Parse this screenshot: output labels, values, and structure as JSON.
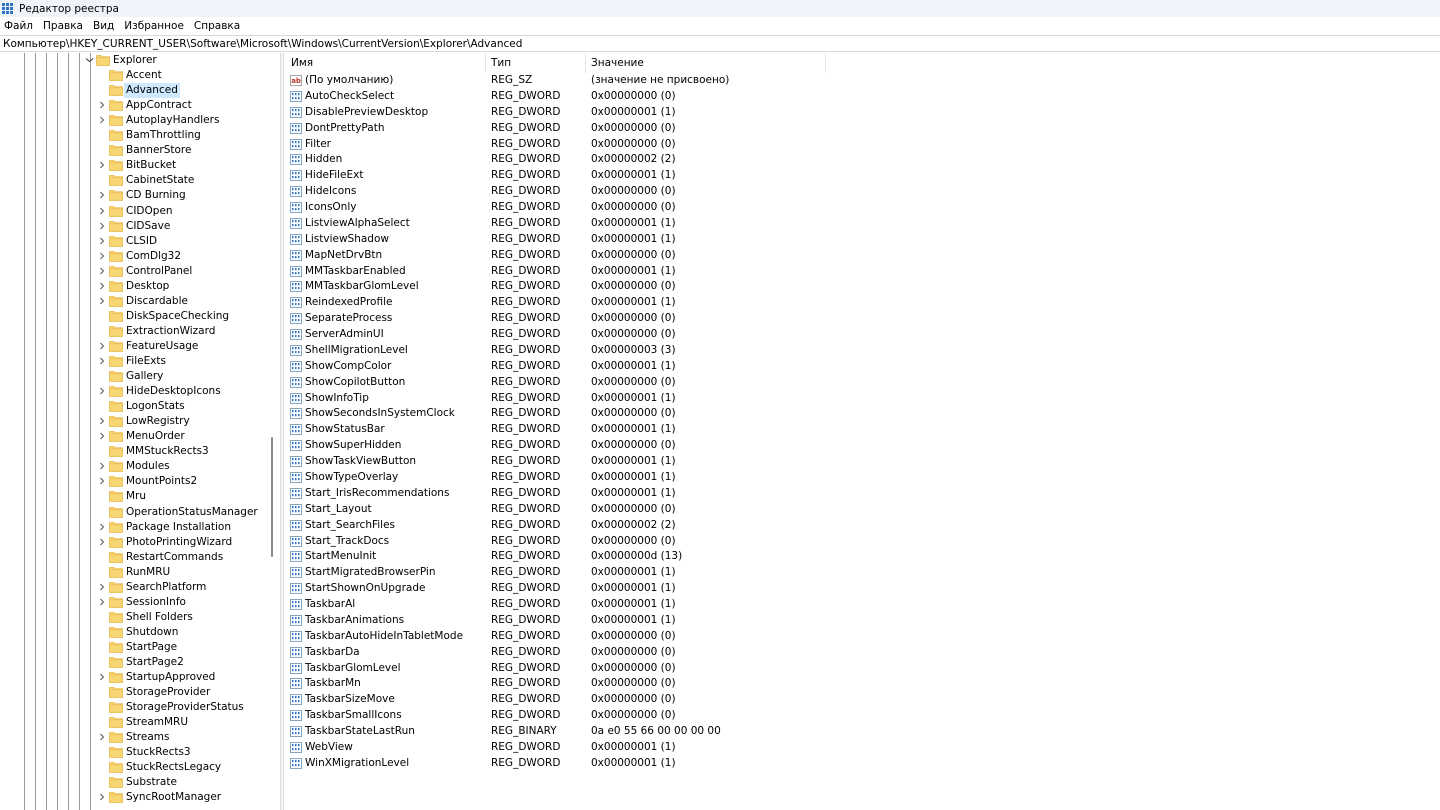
{
  "window": {
    "title": "Редактор реестра"
  },
  "menu": [
    "Файл",
    "Правка",
    "Вид",
    "Избранное",
    "Справка"
  ],
  "address": "Компьютер\\HKEY_CURRENT_USER\\Software\\Microsoft\\Windows\\CurrentVersion\\Explorer\\Advanced",
  "colors": {
    "selection": "#cde8ff",
    "folder": "#f7d774",
    "folder_tab": "#e8b84a",
    "icon_blue": "#2b74c7"
  },
  "tree": [
    {
      "label": "Explorer",
      "expanded": true,
      "depth": 0
    },
    {
      "label": "Accent",
      "has_children": false,
      "depth": 1
    },
    {
      "label": "Advanced",
      "has_children": false,
      "depth": 1,
      "selected": true
    },
    {
      "label": "AppContract",
      "has_children": true,
      "depth": 1
    },
    {
      "label": "AutoplayHandlers",
      "has_children": true,
      "depth": 1
    },
    {
      "label": "BamThrottling",
      "has_children": false,
      "depth": 1
    },
    {
      "label": "BannerStore",
      "has_children": false,
      "depth": 1
    },
    {
      "label": "BitBucket",
      "has_children": true,
      "depth": 1
    },
    {
      "label": "CabinetState",
      "has_children": false,
      "depth": 1
    },
    {
      "label": "CD Burning",
      "has_children": true,
      "depth": 1
    },
    {
      "label": "CIDOpen",
      "has_children": true,
      "depth": 1
    },
    {
      "label": "CIDSave",
      "has_children": true,
      "depth": 1
    },
    {
      "label": "CLSID",
      "has_children": true,
      "depth": 1
    },
    {
      "label": "ComDlg32",
      "has_children": true,
      "depth": 1
    },
    {
      "label": "ControlPanel",
      "has_children": true,
      "depth": 1
    },
    {
      "label": "Desktop",
      "has_children": true,
      "depth": 1
    },
    {
      "label": "Discardable",
      "has_children": true,
      "depth": 1
    },
    {
      "label": "DiskSpaceChecking",
      "has_children": false,
      "depth": 1
    },
    {
      "label": "ExtractionWizard",
      "has_children": false,
      "depth": 1
    },
    {
      "label": "FeatureUsage",
      "has_children": true,
      "depth": 1
    },
    {
      "label": "FileExts",
      "has_children": true,
      "depth": 1
    },
    {
      "label": "Gallery",
      "has_children": false,
      "depth": 1
    },
    {
      "label": "HideDesktopIcons",
      "has_children": true,
      "depth": 1
    },
    {
      "label": "LogonStats",
      "has_children": false,
      "depth": 1
    },
    {
      "label": "LowRegistry",
      "has_children": true,
      "depth": 1
    },
    {
      "label": "MenuOrder",
      "has_children": true,
      "depth": 1
    },
    {
      "label": "MMStuckRects3",
      "has_children": false,
      "depth": 1
    },
    {
      "label": "Modules",
      "has_children": true,
      "depth": 1
    },
    {
      "label": "MountPoints2",
      "has_children": true,
      "depth": 1
    },
    {
      "label": "Mru",
      "has_children": false,
      "depth": 1
    },
    {
      "label": "OperationStatusManager",
      "has_children": false,
      "depth": 1
    },
    {
      "label": "Package Installation",
      "has_children": true,
      "depth": 1
    },
    {
      "label": "PhotoPrintingWizard",
      "has_children": true,
      "depth": 1
    },
    {
      "label": "RestartCommands",
      "has_children": false,
      "depth": 1
    },
    {
      "label": "RunMRU",
      "has_children": false,
      "depth": 1
    },
    {
      "label": "SearchPlatform",
      "has_children": true,
      "depth": 1
    },
    {
      "label": "SessionInfo",
      "has_children": true,
      "depth": 1
    },
    {
      "label": "Shell Folders",
      "has_children": false,
      "depth": 1
    },
    {
      "label": "Shutdown",
      "has_children": false,
      "depth": 1
    },
    {
      "label": "StartPage",
      "has_children": false,
      "depth": 1
    },
    {
      "label": "StartPage2",
      "has_children": false,
      "depth": 1
    },
    {
      "label": "StartupApproved",
      "has_children": true,
      "depth": 1
    },
    {
      "label": "StorageProvider",
      "has_children": false,
      "depth": 1
    },
    {
      "label": "StorageProviderStatus",
      "has_children": false,
      "depth": 1
    },
    {
      "label": "StreamMRU",
      "has_children": false,
      "depth": 1
    },
    {
      "label": "Streams",
      "has_children": true,
      "depth": 1
    },
    {
      "label": "StuckRects3",
      "has_children": false,
      "depth": 1
    },
    {
      "label": "StuckRectsLegacy",
      "has_children": false,
      "depth": 1
    },
    {
      "label": "Substrate",
      "has_children": false,
      "depth": 1
    },
    {
      "label": "SyncRootManager",
      "has_children": true,
      "depth": 1
    }
  ],
  "list": {
    "columns": [
      "Имя",
      "Тип",
      "Значение"
    ],
    "rows": [
      {
        "name": "(По умолчанию)",
        "type": "REG_SZ",
        "value": "(значение не присвоено)",
        "icon": "string-value-icon"
      },
      {
        "name": "AutoCheckSelect",
        "type": "REG_DWORD",
        "value": "0x00000000 (0)",
        "icon": "binary-value-icon"
      },
      {
        "name": "DisablePreviewDesktop",
        "type": "REG_DWORD",
        "value": "0x00000001 (1)",
        "icon": "binary-value-icon"
      },
      {
        "name": "DontPrettyPath",
        "type": "REG_DWORD",
        "value": "0x00000000 (0)",
        "icon": "binary-value-icon"
      },
      {
        "name": "Filter",
        "type": "REG_DWORD",
        "value": "0x00000000 (0)",
        "icon": "binary-value-icon"
      },
      {
        "name": "Hidden",
        "type": "REG_DWORD",
        "value": "0x00000002 (2)",
        "icon": "binary-value-icon"
      },
      {
        "name": "HideFileExt",
        "type": "REG_DWORD",
        "value": "0x00000001 (1)",
        "icon": "binary-value-icon"
      },
      {
        "name": "HideIcons",
        "type": "REG_DWORD",
        "value": "0x00000000 (0)",
        "icon": "binary-value-icon"
      },
      {
        "name": "IconsOnly",
        "type": "REG_DWORD",
        "value": "0x00000000 (0)",
        "icon": "binary-value-icon"
      },
      {
        "name": "ListviewAlphaSelect",
        "type": "REG_DWORD",
        "value": "0x00000001 (1)",
        "icon": "binary-value-icon"
      },
      {
        "name": "ListviewShadow",
        "type": "REG_DWORD",
        "value": "0x00000001 (1)",
        "icon": "binary-value-icon"
      },
      {
        "name": "MapNetDrvBtn",
        "type": "REG_DWORD",
        "value": "0x00000000 (0)",
        "icon": "binary-value-icon"
      },
      {
        "name": "MMTaskbarEnabled",
        "type": "REG_DWORD",
        "value": "0x00000001 (1)",
        "icon": "binary-value-icon"
      },
      {
        "name": "MMTaskbarGlomLevel",
        "type": "REG_DWORD",
        "value": "0x00000000 (0)",
        "icon": "binary-value-icon"
      },
      {
        "name": "ReindexedProfile",
        "type": "REG_DWORD",
        "value": "0x00000001 (1)",
        "icon": "binary-value-icon"
      },
      {
        "name": "SeparateProcess",
        "type": "REG_DWORD",
        "value": "0x00000000 (0)",
        "icon": "binary-value-icon"
      },
      {
        "name": "ServerAdminUI",
        "type": "REG_DWORD",
        "value": "0x00000000 (0)",
        "icon": "binary-value-icon"
      },
      {
        "name": "ShellMigrationLevel",
        "type": "REG_DWORD",
        "value": "0x00000003 (3)",
        "icon": "binary-value-icon"
      },
      {
        "name": "ShowCompColor",
        "type": "REG_DWORD",
        "value": "0x00000001 (1)",
        "icon": "binary-value-icon"
      },
      {
        "name": "ShowCopilotButton",
        "type": "REG_DWORD",
        "value": "0x00000000 (0)",
        "icon": "binary-value-icon"
      },
      {
        "name": "ShowInfoTip",
        "type": "REG_DWORD",
        "value": "0x00000001 (1)",
        "icon": "binary-value-icon"
      },
      {
        "name": "ShowSecondsInSystemClock",
        "type": "REG_DWORD",
        "value": "0x00000000 (0)",
        "icon": "binary-value-icon"
      },
      {
        "name": "ShowStatusBar",
        "type": "REG_DWORD",
        "value": "0x00000001 (1)",
        "icon": "binary-value-icon"
      },
      {
        "name": "ShowSuperHidden",
        "type": "REG_DWORD",
        "value": "0x00000000 (0)",
        "icon": "binary-value-icon"
      },
      {
        "name": "ShowTaskViewButton",
        "type": "REG_DWORD",
        "value": "0x00000001 (1)",
        "icon": "binary-value-icon"
      },
      {
        "name": "ShowTypeOverlay",
        "type": "REG_DWORD",
        "value": "0x00000001 (1)",
        "icon": "binary-value-icon"
      },
      {
        "name": "Start_IrisRecommendations",
        "type": "REG_DWORD",
        "value": "0x00000001 (1)",
        "icon": "binary-value-icon"
      },
      {
        "name": "Start_Layout",
        "type": "REG_DWORD",
        "value": "0x00000000 (0)",
        "icon": "binary-value-icon"
      },
      {
        "name": "Start_SearchFiles",
        "type": "REG_DWORD",
        "value": "0x00000002 (2)",
        "icon": "binary-value-icon"
      },
      {
        "name": "Start_TrackDocs",
        "type": "REG_DWORD",
        "value": "0x00000000 (0)",
        "icon": "binary-value-icon"
      },
      {
        "name": "StartMenuInit",
        "type": "REG_DWORD",
        "value": "0x0000000d (13)",
        "icon": "binary-value-icon"
      },
      {
        "name": "StartMigratedBrowserPin",
        "type": "REG_DWORD",
        "value": "0x00000001 (1)",
        "icon": "binary-value-icon"
      },
      {
        "name": "StartShownOnUpgrade",
        "type": "REG_DWORD",
        "value": "0x00000001 (1)",
        "icon": "binary-value-icon"
      },
      {
        "name": "TaskbarAl",
        "type": "REG_DWORD",
        "value": "0x00000001 (1)",
        "icon": "binary-value-icon"
      },
      {
        "name": "TaskbarAnimations",
        "type": "REG_DWORD",
        "value": "0x00000001 (1)",
        "icon": "binary-value-icon"
      },
      {
        "name": "TaskbarAutoHideInTabletMode",
        "type": "REG_DWORD",
        "value": "0x00000000 (0)",
        "icon": "binary-value-icon"
      },
      {
        "name": "TaskbarDa",
        "type": "REG_DWORD",
        "value": "0x00000000 (0)",
        "icon": "binary-value-icon"
      },
      {
        "name": "TaskbarGlomLevel",
        "type": "REG_DWORD",
        "value": "0x00000000 (0)",
        "icon": "binary-value-icon"
      },
      {
        "name": "TaskbarMn",
        "type": "REG_DWORD",
        "value": "0x00000000 (0)",
        "icon": "binary-value-icon"
      },
      {
        "name": "TaskbarSizeMove",
        "type": "REG_DWORD",
        "value": "0x00000000 (0)",
        "icon": "binary-value-icon"
      },
      {
        "name": "TaskbarSmallIcons",
        "type": "REG_DWORD",
        "value": "0x00000000 (0)",
        "icon": "binary-value-icon"
      },
      {
        "name": "TaskbarStateLastRun",
        "type": "REG_BINARY",
        "value": "0a e0 55 66 00 00 00 00",
        "icon": "binary-value-icon"
      },
      {
        "name": "WebView",
        "type": "REG_DWORD",
        "value": "0x00000001 (1)",
        "icon": "binary-value-icon"
      },
      {
        "name": "WinXMigrationLevel",
        "type": "REG_DWORD",
        "value": "0x00000001 (1)",
        "icon": "binary-value-icon"
      }
    ]
  }
}
